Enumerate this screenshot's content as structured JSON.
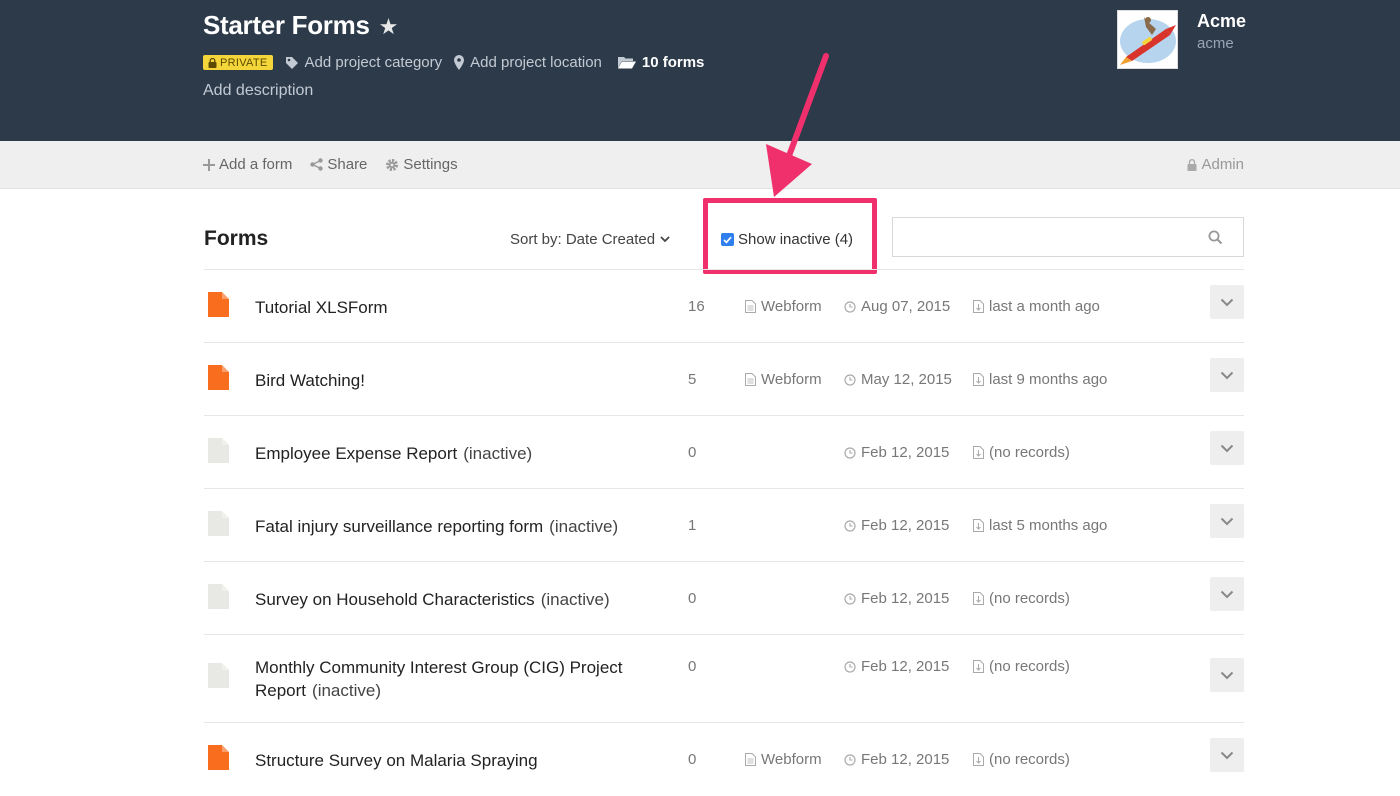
{
  "header": {
    "title": "Starter Forms",
    "private_label": "PRIVATE",
    "category_label": "Add project category",
    "location_label": "Add project location",
    "forms_count_label": "10 forms",
    "description_label": "Add description",
    "user": {
      "name": "Acme",
      "handle": "acme"
    }
  },
  "toolbar": {
    "add_form": "Add a form",
    "share": "Share",
    "settings": "Settings",
    "role": "Admin"
  },
  "list_header": {
    "title": "Forms",
    "sort_label": "Sort by: Date Created",
    "show_inactive_label": "Show inactive (4)",
    "show_inactive_checked": true,
    "search_placeholder": ""
  },
  "colors": {
    "header_bg": "#2c3a4a",
    "active_file": "#f96d1e",
    "inactive_file": "#e8e8e4",
    "highlight": "#f0306c",
    "badge": "#f5d63a"
  },
  "forms": [
    {
      "name": "Tutorial XLSForm",
      "inactive_label": "",
      "active": true,
      "records": "16",
      "type": "Webform",
      "created": "Aug 07, 2015",
      "updated": "last a month ago"
    },
    {
      "name": "Bird Watching!",
      "inactive_label": "",
      "active": true,
      "records": "5",
      "type": "Webform",
      "created": "May 12, 2015",
      "updated": "last 9 months ago"
    },
    {
      "name": "Employee Expense Report",
      "inactive_label": "(inactive)",
      "active": false,
      "records": "0",
      "type": "",
      "created": "Feb 12, 2015",
      "updated": "(no records)"
    },
    {
      "name": "Fatal injury surveillance reporting form",
      "inactive_label": "(inactive)",
      "active": false,
      "records": "1",
      "type": "",
      "created": "Feb 12, 2015",
      "updated": "last 5 months ago"
    },
    {
      "name": "Survey on Household Characteristics",
      "inactive_label": "(inactive)",
      "active": false,
      "records": "0",
      "type": "",
      "created": "Feb 12, 2015",
      "updated": "(no records)"
    },
    {
      "name": "Monthly Community Interest Group (CIG) Project Report",
      "inactive_label": "(inactive)",
      "active": false,
      "records": "0",
      "type": "",
      "created": "Feb 12, 2015",
      "updated": "(no records)"
    },
    {
      "name": "Structure Survey on Malaria Spraying",
      "inactive_label": "",
      "active": true,
      "records": "0",
      "type": "Webform",
      "created": "Feb 12, 2015",
      "updated": "(no records)"
    }
  ]
}
